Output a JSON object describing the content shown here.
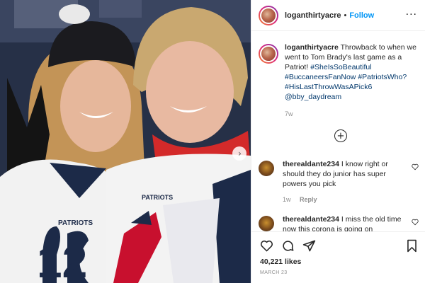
{
  "post": {
    "author": "loganthirtyacre",
    "follow_label": "Follow",
    "separator": "•",
    "more_label": "···",
    "caption": {
      "username": "loganthirtyacre",
      "text": "Throwback to when we went to Tom Brady's last game as a Patriot!",
      "hashtags": [
        "#SheIsSoBeautiful",
        "#BuccaneersFanNow",
        "#PatriotsWho?",
        "#HisLastThrowWasAPick6"
      ],
      "mention": "@bby_daydream",
      "time": "7w"
    },
    "load_more_icon": "plus-circle-icon",
    "comments": [
      {
        "username": "therealdante234",
        "text": "I know right or should they do junior has super powers you pick",
        "time": "1w",
        "reply_label": "Reply"
      },
      {
        "username": "therealdante234",
        "text": "I miss the old time now this corona is going on",
        "time": "",
        "reply_label": ""
      }
    ],
    "likes": "40,221 likes",
    "date": "MARCH 23",
    "icons": [
      "heart-icon",
      "comment-icon",
      "share-icon",
      "bookmark-icon",
      "chevron-right-icon"
    ],
    "photo_text": {
      "jersey_left_number": "12",
      "jersey_wordmark": "PATRIOTS"
    }
  },
  "colors": {
    "link": "#0095f6",
    "hashtag": "#00376b",
    "muted": "#8e8e8e",
    "text": "#262626",
    "patriots_navy": "#1c2a48",
    "patriots_red": "#c8102e"
  }
}
